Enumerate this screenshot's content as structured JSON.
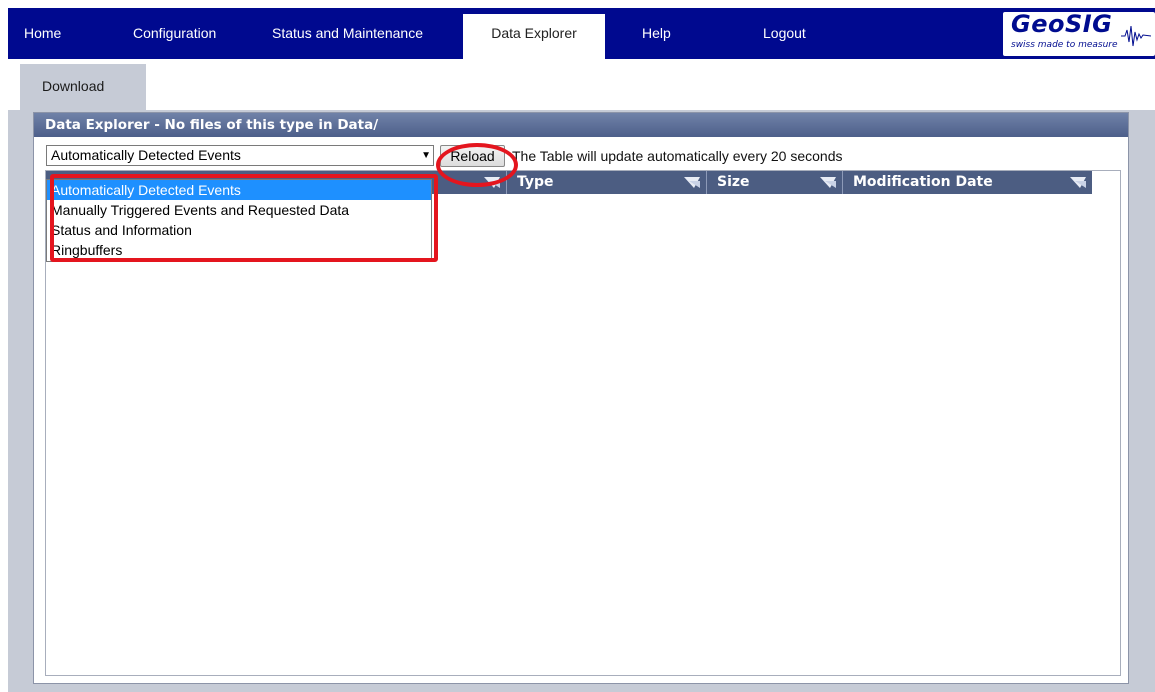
{
  "nav": {
    "items": [
      "Home",
      "Configuration",
      "Status and Maintenance",
      "Data Explorer",
      "Help",
      "Logout"
    ],
    "active": "Data Explorer"
  },
  "logo": {
    "name": "GeoSIG",
    "tagline": "swiss made to measure"
  },
  "subtab": {
    "label": "Download"
  },
  "panel": {
    "title": "Data Explorer - No files of this type in Data/",
    "select": {
      "value": "Automatically Detected Events",
      "options": [
        "Automatically Detected Events",
        "Manually Triggered Events and Requested Data",
        "Status and Information",
        "Ringbuffers"
      ]
    },
    "reload_label": "Reload",
    "refresh_note": "The Table will update automatically every 20 seconds",
    "table": {
      "columns": [
        "Type",
        "Size",
        "Modification Date"
      ]
    }
  },
  "colors": {
    "nav_bg": "#00098f",
    "panel_head": "#4c5d82",
    "highlight": "#e4151e",
    "selected_option": "#1e90ff"
  }
}
